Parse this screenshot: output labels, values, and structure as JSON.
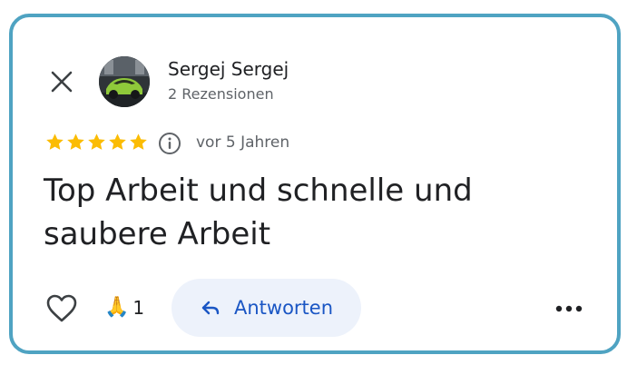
{
  "review": {
    "author": {
      "name": "Sergej Sergej",
      "meta": "2 Rezensionen",
      "avatar": "car-photo-avatar"
    },
    "rating": {
      "stars": 5,
      "max": 5,
      "color": "#fbbc04"
    },
    "time": "vor 5 Jahren",
    "text": "Top Arbeit und schnelle und saubere Arbeit",
    "reaction": {
      "emoji": "🙏",
      "count": "1"
    },
    "actions": {
      "close_icon": "close-icon",
      "like_icon": "heart-outline-icon",
      "info_icon": "info-icon",
      "reply_label": "Antworten",
      "reply_icon": "reply-arrow-icon",
      "more_icon": "more-horizontal-icon"
    }
  },
  "colors": {
    "card_border": "#4fa3c2",
    "accent": "#1a56c4",
    "reply_bg": "#edf2fb",
    "text_primary": "#202124",
    "text_secondary": "#5f6368"
  }
}
